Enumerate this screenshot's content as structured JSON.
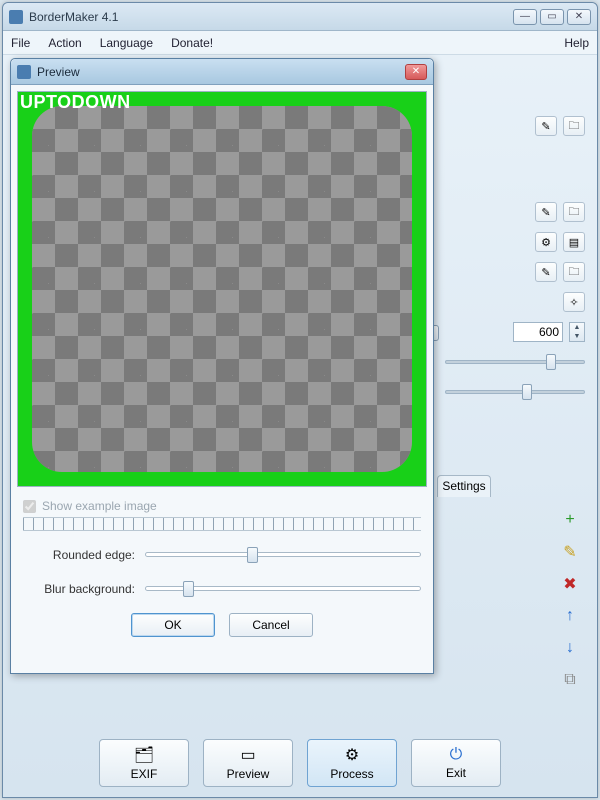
{
  "app": {
    "title": "BorderMaker 4.1"
  },
  "menu": {
    "file": "File",
    "action": "Action",
    "language": "Language",
    "donate": "Donate!",
    "help": "Help"
  },
  "controls": {
    "numeric_value": "600",
    "slider1_pos_pct": 78,
    "slider2_pos_pct": 60,
    "tab_label": "Settings"
  },
  "side_icons": {
    "add": "+",
    "edit": "✎",
    "delete": "✖",
    "up": "↑",
    "down": "↓",
    "copy": "⧉"
  },
  "bottom": {
    "exif": "EXIF",
    "preview": "Preview",
    "process": "Process",
    "exit": "Exit"
  },
  "dialog": {
    "title": "Preview",
    "watermark": "UPTODOWN",
    "show_example": "Show example image",
    "rounded_label": "Rounded edge:",
    "rounded_pos_pct": 38,
    "blur_label": "Blur background:",
    "blur_pos_pct": 14,
    "ok": "OK",
    "cancel": "Cancel",
    "border_color": "#18d018"
  }
}
